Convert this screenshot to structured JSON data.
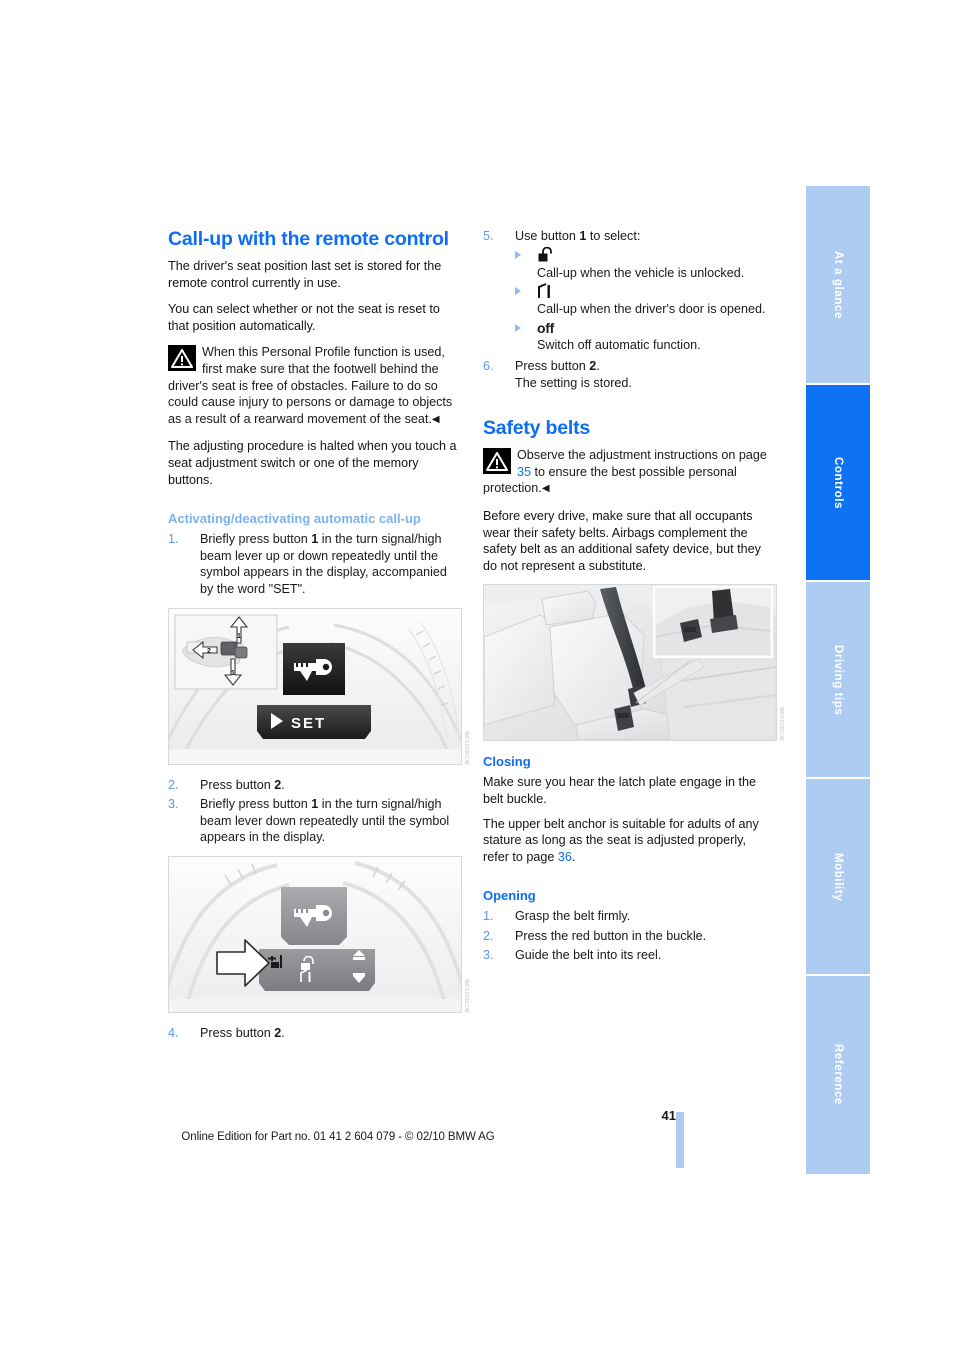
{
  "document": {
    "page_number": "41",
    "edition_line": "Online Edition for Part no. 01 41 2 604 079 - © 02/10 BMW AG"
  },
  "index_tabs": [
    {
      "label": "At a glance",
      "active": false
    },
    {
      "label": "Controls",
      "active": true
    },
    {
      "label": "Driving tips",
      "active": false
    },
    {
      "label": "Mobility",
      "active": false
    },
    {
      "label": "Reference",
      "active": false
    }
  ],
  "left_column": {
    "heading": "Call-up with the remote control",
    "para1": "The driver's seat position last set is stored for the remote control currently in use.",
    "para2": "You can select whether or not the seat is reset to that position automatically.",
    "warning": {
      "icon": "warning-triangle-icon",
      "text": "When this Personal Profile function is used, first make sure that the footwell behind the driver's seat is free of obstacles. Failure to do so could cause injury to persons or damage to objects as a result of a rearward movement of the seat.",
      "end_mark": "◀"
    },
    "para3": "The adjusting procedure is halted when you touch a seat adjustment switch or one of the memory buttons.",
    "subheading": "Activating/deactivating automatic call-up",
    "steps": [
      {
        "num": "1.",
        "pre": "Briefly press button ",
        "bold": "1",
        "post": " in the turn signal/high beam lever up or down repeatedly until the symbol appears in the display, accompanied by the word \"SET\"."
      },
      {
        "num": "2.",
        "pre": "Press button ",
        "bold": "2",
        "post": "."
      },
      {
        "num": "3.",
        "pre": "Briefly press button ",
        "bold": "1",
        "post": " in the turn signal/high beam lever down repeatedly until the symbol appears in the display."
      },
      {
        "num": "4.",
        "pre": "Press button ",
        "bold": "2",
        "post": "."
      }
    ],
    "figure1": {
      "name": "instrument-cluster-set-figure",
      "display_text": "SET",
      "callout_1": "1",
      "callout_2": "2",
      "code": "WKS0080CM"
    },
    "figure2": {
      "name": "instrument-cluster-menu-figure",
      "code": "WKS0081CM"
    }
  },
  "right_column": {
    "step5": {
      "num": "5.",
      "pre": "Use button ",
      "bold": "1",
      "post": " to select:"
    },
    "options": [
      {
        "glyph": "unlocked-padlock-icon",
        "text": "Call-up when the vehicle is unlocked."
      },
      {
        "glyph": "open-door-icon",
        "text": "Call-up when the driver's door is opened."
      },
      {
        "glyph": "off-label",
        "label": "off",
        "text": "Switch off automatic function."
      }
    ],
    "step6": {
      "num": "6.",
      "pre": "Press button ",
      "bold": "2",
      "post": ".",
      "line2": "The setting is stored."
    },
    "heading": "Safety belts",
    "warning": {
      "icon": "warning-triangle-icon",
      "text_before": "Observe the adjustment instructions on page ",
      "page_ref": "35",
      "text_after": " to ensure the best possible personal protection.",
      "end_mark": "◀"
    },
    "intro": "Before every drive, make sure that all occupants wear their safety belts. Airbags complement the safety belt as an additional safety device, but they do not represent a substitute.",
    "figure": {
      "name": "safety-belt-figure",
      "code": "WKS0082CM"
    },
    "closing_heading": "Closing",
    "closing_p1": "Make sure you hear the latch plate engage in the belt buckle.",
    "closing_p2_before": "The upper belt anchor is suitable for adults of any stature as long as the seat is adjusted properly, refer to page ",
    "closing_p2_ref": "36",
    "closing_p2_after": ".",
    "opening_heading": "Opening",
    "opening_steps": [
      {
        "num": "1.",
        "text": "Grasp the belt firmly."
      },
      {
        "num": "2.",
        "text": "Press the red button in the buckle."
      },
      {
        "num": "3.",
        "text": "Guide the belt into its reel."
      }
    ]
  },
  "colors": {
    "accent_blue": "#0d6ef5",
    "tint_blue": "#7eb2ef",
    "tab_blue": "#aecbf2",
    "tab_active": "#0e72f5",
    "number_blue": "#5b9ae8"
  }
}
